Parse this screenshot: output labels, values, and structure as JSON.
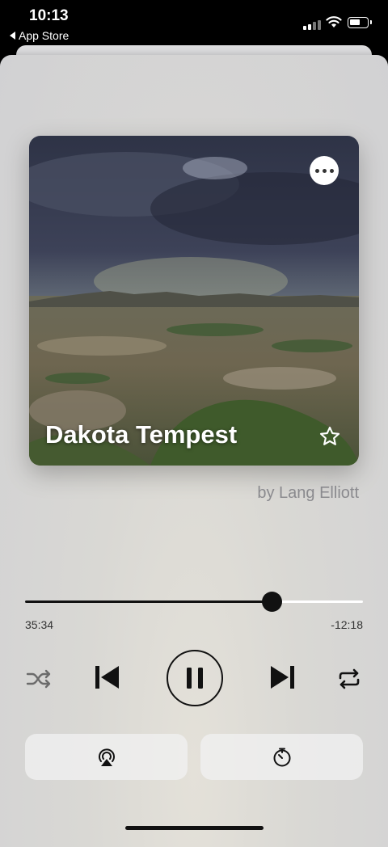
{
  "status_bar": {
    "time": "10:13",
    "back_app": "App Store",
    "icons": [
      "cellular-signal-icon",
      "wifi-icon",
      "battery-icon"
    ]
  },
  "player": {
    "track_title": "Dakota Tempest",
    "artist": "by Lang Elliott",
    "progress": {
      "elapsed": "35:34",
      "remaining": "-12:18",
      "fraction": 0.73
    },
    "controls": {
      "shuffle": "shuffle-icon",
      "previous": "skip-back-icon",
      "play_pause": "pause-icon",
      "next": "skip-forward-icon",
      "repeat": "repeat-icon"
    },
    "bottom_buttons": [
      "airplay-icon",
      "sleep-timer-icon"
    ],
    "artwork_actions": [
      "more-icon",
      "favorite-star-icon"
    ]
  },
  "colors": {
    "accent": "#111111",
    "secondary_text": "#8a8a8e",
    "sheet_background": "#d6d6d6"
  }
}
